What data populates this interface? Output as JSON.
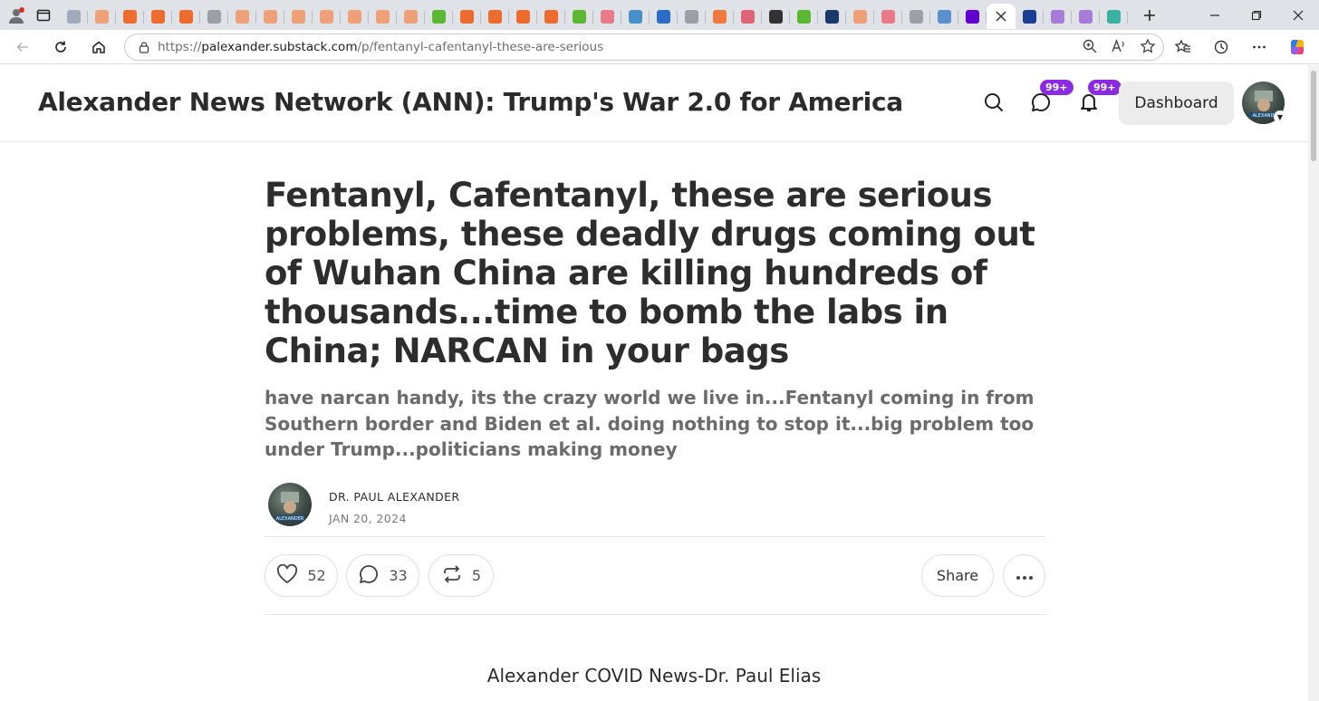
{
  "browser": {
    "url_prefix": "https://",
    "url_host": "palexander.substack.com",
    "url_path": "/p/fentanyl-cafentanyl-these-are-serious",
    "tabs": [
      {
        "icon": "search-favicon",
        "color": "#a0aabb"
      },
      {
        "icon": "substack-favicon",
        "color": "#f0a078"
      },
      {
        "icon": "substack-favicon",
        "color": "#ee6b2e"
      },
      {
        "icon": "substack-favicon",
        "color": "#ee6b2e"
      },
      {
        "icon": "substack-favicon",
        "color": "#ee6b2e"
      },
      {
        "icon": "generic-favicon",
        "color": "#9aa0a6"
      },
      {
        "icon": "substack-favicon",
        "color": "#f0a078"
      },
      {
        "icon": "substack-favicon",
        "color": "#f0a078"
      },
      {
        "icon": "substack-favicon",
        "color": "#f0a078"
      },
      {
        "icon": "substack-favicon",
        "color": "#f0a078"
      },
      {
        "icon": "substack-favicon",
        "color": "#f0a078"
      },
      {
        "icon": "substack-favicon",
        "color": "#f0a078"
      },
      {
        "icon": "substack-favicon",
        "color": "#f0a078"
      },
      {
        "icon": "rumble-favicon",
        "color": "#5cb833"
      },
      {
        "icon": "substack-favicon",
        "color": "#ee6b2e"
      },
      {
        "icon": "substack-favicon",
        "color": "#ee6b2e"
      },
      {
        "icon": "substack-favicon",
        "color": "#ee6b2e"
      },
      {
        "icon": "substack-favicon",
        "color": "#ee6b2e"
      },
      {
        "icon": "rumble-favicon",
        "color": "#5cb833"
      },
      {
        "icon": "youtube-favicon",
        "color": "#e87a8a"
      },
      {
        "icon": "translate-favicon",
        "color": "#4a90c8"
      },
      {
        "icon": "search-favicon",
        "color": "#2b6cc4"
      },
      {
        "icon": "gp-favicon",
        "color": "#9aa0a6"
      },
      {
        "icon": "blogger-favicon",
        "color": "#f07a3e"
      },
      {
        "icon": "youtube-favicon",
        "color": "#e06478"
      },
      {
        "icon": "openai-favicon",
        "color": "#333333"
      },
      {
        "icon": "rumble-favicon",
        "color": "#5cb833"
      },
      {
        "icon": "foxnews-favicon",
        "color": "#1a3a6b"
      },
      {
        "icon": "substack-favicon",
        "color": "#f0a078"
      },
      {
        "icon": "youtube-favicon",
        "color": "#e87a8a"
      },
      {
        "icon": "generic-favicon",
        "color": "#9aa0a6"
      },
      {
        "icon": "link-favicon",
        "color": "#5a8fd0"
      },
      {
        "icon": "yahoo-favicon",
        "color": "#6001d2"
      },
      {
        "icon": "close-tab-icon",
        "color": "#333333",
        "active": true
      },
      {
        "icon": "m-favicon",
        "color": "#1c3f94"
      },
      {
        "icon": "yahoo-favicon",
        "color": "#a77bd8"
      },
      {
        "icon": "yahoo-favicon",
        "color": "#a77bd8"
      },
      {
        "icon": "edge-favicon",
        "color": "#3ab0a0"
      }
    ],
    "badge_notifications": "99+",
    "badge_messages": "99+"
  },
  "site": {
    "title": "Alexander News Network (ANN): Trump's War 2.0 for America",
    "dashboard_label": "Dashboard",
    "accent_color": "#8a2be2"
  },
  "article": {
    "headline": "Fentanyl, Cafentanyl, these are serious problems, these deadly drugs coming out of Wuhan China are killing hundreds of thousands...time to bomb the labs in China; NARCAN in your bags",
    "subtitle": "have narcan handy, its the crazy world we live in...Fentanyl coming in from Southern border and Biden et al. doing nothing to stop it...big problem too under Trump...politicians making money",
    "author": "DR. PAUL ALEXANDER",
    "date": "JAN 20, 2024",
    "likes": "52",
    "comments": "33",
    "restacks": "5",
    "share_label": "Share",
    "body_first_line": "Alexander COVID News-Dr. Paul Elias"
  }
}
